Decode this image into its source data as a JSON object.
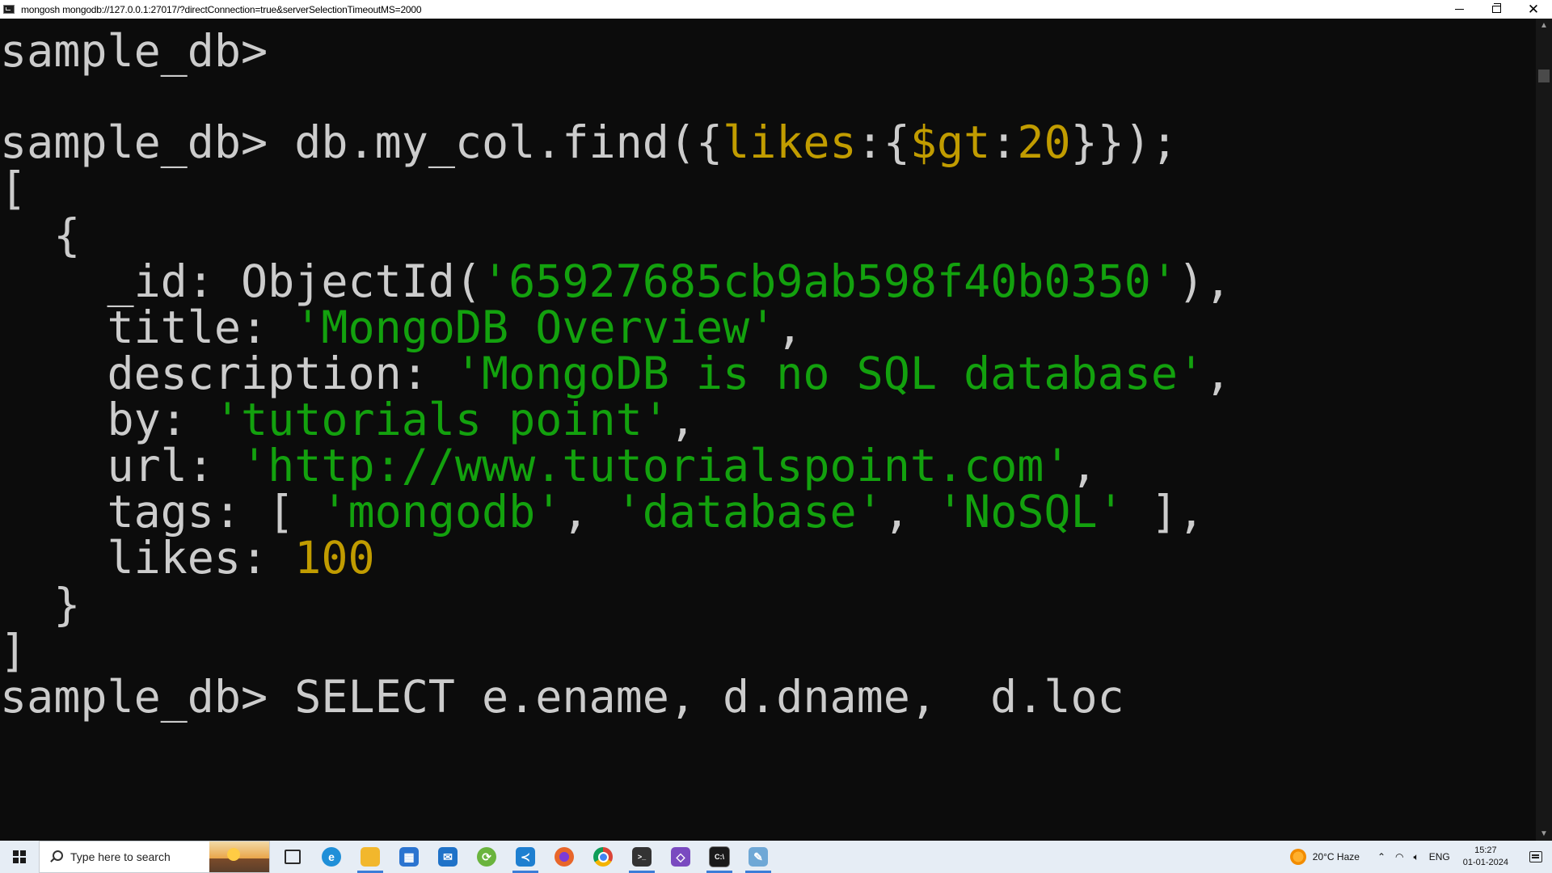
{
  "window": {
    "title": "mongosh mongodb://127.0.0.1:27017/?directConnection=true&serverSelectionTimeoutMS=2000",
    "minimize_glyph": "—",
    "close_glyph": "✕"
  },
  "console": {
    "prompt": "sample_db>",
    "command": {
      "prefix": "db.my_col.find({",
      "field": "likes",
      "colon1": ":{",
      "operator": "$gt",
      "colon2": ":",
      "value": "20",
      "suffix": "}});"
    },
    "open_bracket": "[",
    "open_brace": "{",
    "doc": {
      "id_key": "_id: ObjectId(",
      "id_value": "'65927685cb9ab598f40b0350'",
      "id_close": "),",
      "title_key": "title: ",
      "title_value": "'MongoDB Overview'",
      "description_key": "description: ",
      "description_value": "'MongoDB is no SQL database'",
      "by_key": "by: ",
      "by_value": "'tutorials point'",
      "url_key": "url: ",
      "url_value": "'http://www.tutorialspoint.com'",
      "tags_key": "tags: [ ",
      "tags": [
        "'mongodb'",
        "'database'",
        "'NoSQL'"
      ],
      "tags_close": " ],",
      "likes_key": "likes: ",
      "likes_value": "100"
    },
    "close_brace": "}",
    "close_bracket": "]",
    "partial_line": "sample_db> SELECT e.ename, d.dname,  d.loc"
  },
  "taskbar": {
    "search_placeholder": "Type here to search",
    "weather": "20°C  Haze",
    "language": "ENG",
    "time": "15:27",
    "date": "01-01-2024",
    "pinned_apps": [
      {
        "name": "task-view",
        "color": "#2b2b2b"
      },
      {
        "name": "edge",
        "color": "#1f8fd8"
      },
      {
        "name": "file-explorer",
        "color": "#f2b72c"
      },
      {
        "name": "microsoft-store",
        "color": "#2b74d0"
      },
      {
        "name": "mail",
        "color": "#1f72c8"
      },
      {
        "name": "spring-tools",
        "color": "#6ab43e"
      },
      {
        "name": "vs-code",
        "color": "#1e7fd0"
      },
      {
        "name": "firefox",
        "color": "#e8662a"
      },
      {
        "name": "chrome",
        "color": "#3a8f3a"
      },
      {
        "name": "terminal-app",
        "color": "#333333"
      },
      {
        "name": "visual-studio",
        "color": "#7a4ac0"
      },
      {
        "name": "command-prompt",
        "color": "#1a1a1a"
      },
      {
        "name": "paint",
        "color": "#6fa8d6"
      }
    ]
  }
}
